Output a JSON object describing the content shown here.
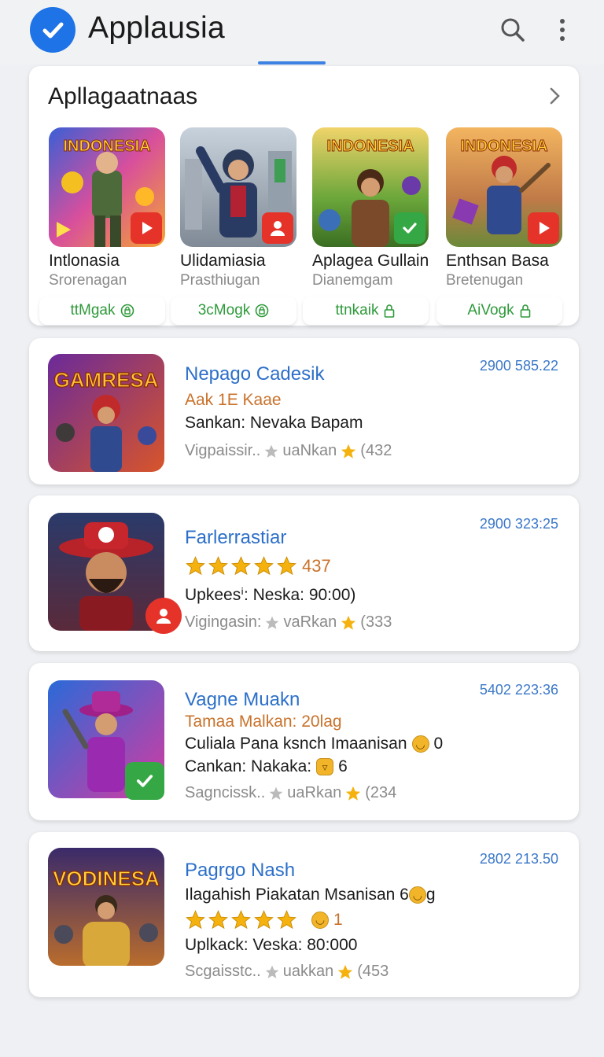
{
  "app_bar": {
    "title": "Applausia",
    "icons": [
      "check-logo-icon",
      "search-icon",
      "more-vert-icon"
    ]
  },
  "featured": {
    "heading": "Apllagaatnaas",
    "apps": [
      {
        "art_text": "INDONESIA",
        "name": "Intlonasia",
        "sub": "Srorenagan",
        "price": "ttMgak",
        "badge": "play-icon",
        "price_icon": "lock-circle-icon"
      },
      {
        "art_text": "",
        "name": "Ulidamiasia",
        "sub": "Prasthiugan",
        "price": "3cMogk",
        "badge": "person-icon",
        "price_icon": "lock-circle-icon"
      },
      {
        "art_text": "INDONESIA",
        "name": "Aplagea Gullain",
        "sub": "Dianemgam",
        "price": "ttnkaik",
        "badge": "check-icon",
        "price_icon": "lock-icon"
      },
      {
        "art_text": "INDONESIA",
        "name": "Enthsan Basa",
        "sub": "Bretenugan",
        "price": "AiVogk",
        "badge": "play-icon",
        "price_icon": "lock-icon"
      }
    ]
  },
  "list": [
    {
      "art_text": "GAMRESA",
      "title": "Nepago Cadesik",
      "meta": "2900 585.22",
      "lines": [
        {
          "text": "Aak 1E Kaae",
          "style": "orange"
        },
        {
          "text": "Sankan: Nevaka Bapam",
          "style": ""
        }
      ],
      "footer_left": "Vigpaissir..",
      "footer_mid": "uaNkan",
      "footer_right": "(432"
    },
    {
      "art_text": "",
      "title": "Farlerrastiar",
      "meta": "2900 323:25",
      "rating_count": "437",
      "rating": 5,
      "lines": [
        {
          "text": "Upkeesⁱ: Neska: 90:00)",
          "style": ""
        }
      ],
      "footer_left": "Vigingasin:",
      "footer_mid": "vaRkan",
      "footer_right": "(333"
    },
    {
      "art_text": "",
      "title": "Vagne Muakn",
      "meta": "5402 223:36",
      "lines": [
        {
          "text": "Tamaa Malkan: 20lag",
          "style": "orange"
        },
        {
          "text": "Culiala Pana ksnch Imaanisan",
          "style": "",
          "suffix": "0"
        },
        {
          "text": "Cankan: Nakaka:",
          "style": "",
          "suffix": "6"
        }
      ],
      "footer_left": "Sagncissk..",
      "footer_mid": "uaRkan",
      "footer_right": "(234"
    },
    {
      "art_text": "VODINESA",
      "title": "Pagrgo Nash",
      "meta": "2802 213.50",
      "rating": 5,
      "rating_suffix": "1",
      "lines": [
        {
          "text": "Ilagahish Piakatan Msanisan 6",
          "style": "",
          "suffix": "g"
        },
        {
          "text": "Uplkack: Veska: 80:000",
          "style": ""
        }
      ],
      "footer_left": "Scgaisstc..",
      "footer_mid": "uakkan",
      "footer_right": "(453"
    }
  ],
  "colors": {
    "accent": "#1e73e6",
    "link": "#2c6fc9",
    "price_green": "#2e9a3a",
    "orange": "#c9722b",
    "star": "#f5b20f"
  }
}
